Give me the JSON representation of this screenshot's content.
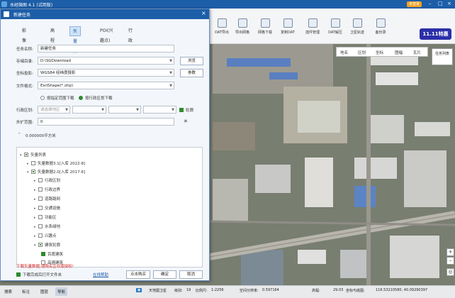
{
  "app": {
    "title": "水经微图 4.1 (试用版)",
    "login": "未登录"
  },
  "toolbar": {
    "items": [
      "DAT导出",
      "导出网格",
      "网格下载",
      "复制DAT",
      "插件管理",
      "DAT解压",
      "卫星轨迹",
      "备份录"
    ],
    "badge": "11.11特惠"
  },
  "map": {
    "tabs": [
      "地名",
      "区划",
      "坐标",
      "图幅",
      "瓦片"
    ],
    "task_button": "任务列表"
  },
  "dialog": {
    "title": "新建任务",
    "tabs": [
      "影像",
      "高程",
      "矢量数据",
      "POI(兴趣点)",
      "行政区划"
    ],
    "task_name_label": "任务名称:",
    "task_name": "新建任务",
    "save_dir_label": "存储目录:",
    "save_dir": "D:\\SGDownload",
    "browse": "浏览",
    "coord_label": "坐标投影:",
    "coord": "WGS84 经纬度投影",
    "params": "参数",
    "format_label": "文件格式:",
    "format": "EsriShape(*.shp)",
    "radio_range": "按指定范围下载",
    "radio_region": "按行政区划下载",
    "region_label": "行政区划:",
    "region_placeholder": "请选择地区",
    "outline": "轮廓",
    "buffer_label": "外扩范围:",
    "buffer_value": "0",
    "area": "0.000000平方米",
    "tree": {
      "root": "矢量列表",
      "n1": "矢量数据3.1[入库 2022-8]",
      "n2": "矢量数据2.0[入库 2017-6]",
      "children": [
        "行政区划",
        "行政边界",
        "道路路网",
        "交通设施",
        "功能区",
        "水系绿地",
        "兴趣点",
        "建筑轮廓"
      ],
      "leaf1": "百度建筑",
      "leaf2": "高德建筑"
    },
    "warning": "下载矢量数据,请购买企业版授权!",
    "open_folder": "下载完成后打开文件夹",
    "online_help": "在线帮助",
    "buy": "点击购买",
    "ok": "确定",
    "cancel": "取消"
  },
  "status": {
    "tabs": [
      "搜索",
      "标注",
      "图层",
      "导航"
    ],
    "source": "天地图卫星",
    "level_label": "级别:",
    "level": "19",
    "scale_label": "比例尺:",
    "scale": "1:2256",
    "res_label": "空间分辨率:",
    "res": "0.597164",
    "elev_label": "高程:",
    "elev": "29.03",
    "coord_label": "坐标与底图:",
    "coord": "116.53210580, 40.09290397"
  },
  "colors": {
    "accent": "#1d5ea8",
    "badge": "#2b2fa8",
    "warning": "#d42020"
  }
}
